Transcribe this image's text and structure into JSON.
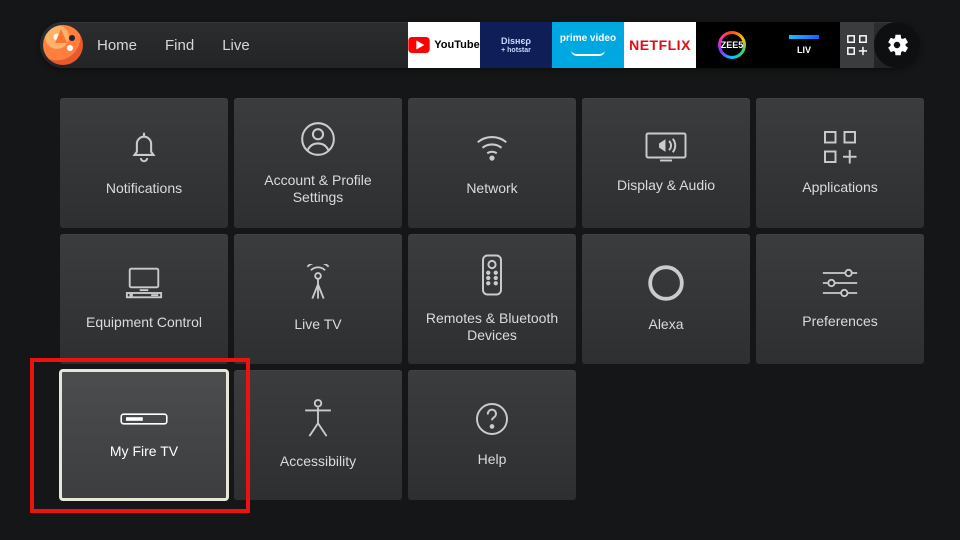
{
  "profile": {
    "name": "fox-avatar"
  },
  "nav": {
    "home": "Home",
    "find": "Find",
    "live": "Live"
  },
  "apps": {
    "youtube": "YouTube",
    "disneyplus": "Disney+ hotstar",
    "primevideo": "prime video",
    "netflix": "NETFLIX",
    "zee5": "ZEE5",
    "sonyliv": "LIV"
  },
  "settings": {
    "tiles": [
      {
        "id": "notifications",
        "label": "Notifications"
      },
      {
        "id": "account",
        "label": "Account & Profile Settings"
      },
      {
        "id": "network",
        "label": "Network"
      },
      {
        "id": "display-audio",
        "label": "Display & Audio"
      },
      {
        "id": "applications",
        "label": "Applications"
      },
      {
        "id": "equipment",
        "label": "Equipment Control"
      },
      {
        "id": "live-tv",
        "label": "Live TV"
      },
      {
        "id": "remotes",
        "label": "Remotes & Bluetooth Devices"
      },
      {
        "id": "alexa",
        "label": "Alexa"
      },
      {
        "id": "preferences",
        "label": "Preferences"
      },
      {
        "id": "my-fire-tv",
        "label": "My Fire TV"
      },
      {
        "id": "accessibility",
        "label": "Accessibility"
      },
      {
        "id": "help",
        "label": "Help"
      }
    ],
    "selected": "my-fire-tv"
  },
  "annotation": {
    "highlight_tile": "my-fire-tv"
  }
}
